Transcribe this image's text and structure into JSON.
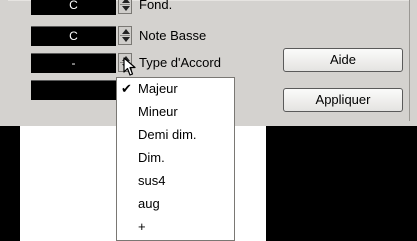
{
  "fields": [
    {
      "value": "C",
      "label": "Fond."
    },
    {
      "value": "C",
      "label": "Note Basse"
    },
    {
      "value": "-",
      "label": "Type d'Accord"
    },
    {
      "value": "",
      "label": ""
    }
  ],
  "buttons": {
    "help_label": "Aide",
    "apply_label": "Appliquer"
  },
  "chord_type_menu": {
    "items": [
      {
        "label": "Majeur",
        "checked": true
      },
      {
        "label": "Mineur",
        "checked": false
      },
      {
        "label": "Demi dim.",
        "checked": false
      },
      {
        "label": "Dim.",
        "checked": false
      },
      {
        "label": "sus4",
        "checked": false
      },
      {
        "label": "aug",
        "checked": false
      },
      {
        "label": "+",
        "checked": false
      }
    ],
    "check_glyph": "✔"
  },
  "icons": {
    "spin_control": "up-down-arrows-icon",
    "checkmark": "checkmark-icon",
    "cursor": "mouse-pointer-icon"
  }
}
